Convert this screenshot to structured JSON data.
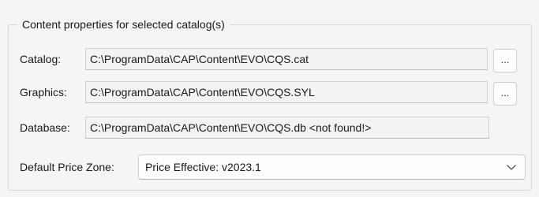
{
  "group": {
    "title": "Content properties for selected catalog(s)"
  },
  "catalog": {
    "label": "Catalog:",
    "value": "C:\\ProgramData\\CAP\\Content\\EVO\\CQS.cat",
    "browse_label": "..."
  },
  "graphics": {
    "label": "Graphics:",
    "value": "C:\\ProgramData\\CAP\\Content\\EVO\\CQS.SYL",
    "browse_label": "..."
  },
  "database": {
    "label": "Database:",
    "value": "C:\\ProgramData\\CAP\\Content\\EVO\\CQS.db <not found!>"
  },
  "price_zone": {
    "label": "Default Price Zone:",
    "selected": "Price Effective: v2023.1",
    "icon": "chevron-down-icon"
  }
}
